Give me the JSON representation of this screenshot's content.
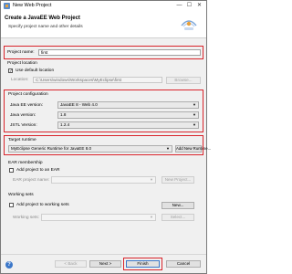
{
  "window": {
    "title": "New Web Project",
    "minimize_glyph": "—",
    "maximize_glyph": "☐",
    "close_glyph": "✕"
  },
  "header": {
    "title": "Create a JavaEE Web Project",
    "subtitle": "Specify project name and other details"
  },
  "project_name": {
    "label": "Project name:",
    "value": "first"
  },
  "project_location": {
    "group_title": "Project location",
    "use_default_label": "Use default location",
    "use_default_checked": true,
    "location_label": "Location:",
    "location_value": "C:\\Users\\windows\\Workspaces\\MyEclipse\\first",
    "browse_label": "Browse..."
  },
  "project_configuration": {
    "group_title": "Project configuration",
    "javaee_label": "Java EE version:",
    "javaee_value": "JavaEE 8 - Web 4.0",
    "java_label": "Java version:",
    "java_value": "1.8",
    "jstl_label": "JSTL Version:",
    "jstl_value": "1.2.4"
  },
  "target_runtime": {
    "group_title": "Target runtime",
    "value": "MyEclipse Generic Runtime for JavaEE 8.0",
    "add_label": "Add New Runtime..."
  },
  "ear_membership": {
    "group_title": "EAR membership",
    "add_label": "Add project to an EAR",
    "name_label": "EAR project name:",
    "new_project_label": "New Project..."
  },
  "working_sets": {
    "group_title": "Working sets",
    "add_label": "Add project to working sets",
    "sets_label": "Working sets:",
    "new_label": "New...",
    "select_label": "Select..."
  },
  "footer": {
    "help_glyph": "?",
    "back_label": "< Back",
    "next_label": "Next >",
    "finish_label": "Finish",
    "cancel_label": "Cancel"
  },
  "colors": {
    "highlight": "#d9242b",
    "dialog_bg": "#f0f0f0"
  },
  "icons": [
    "app-icon",
    "javaee-logo-icon",
    "chevron-down-icon",
    "help-icon"
  ]
}
